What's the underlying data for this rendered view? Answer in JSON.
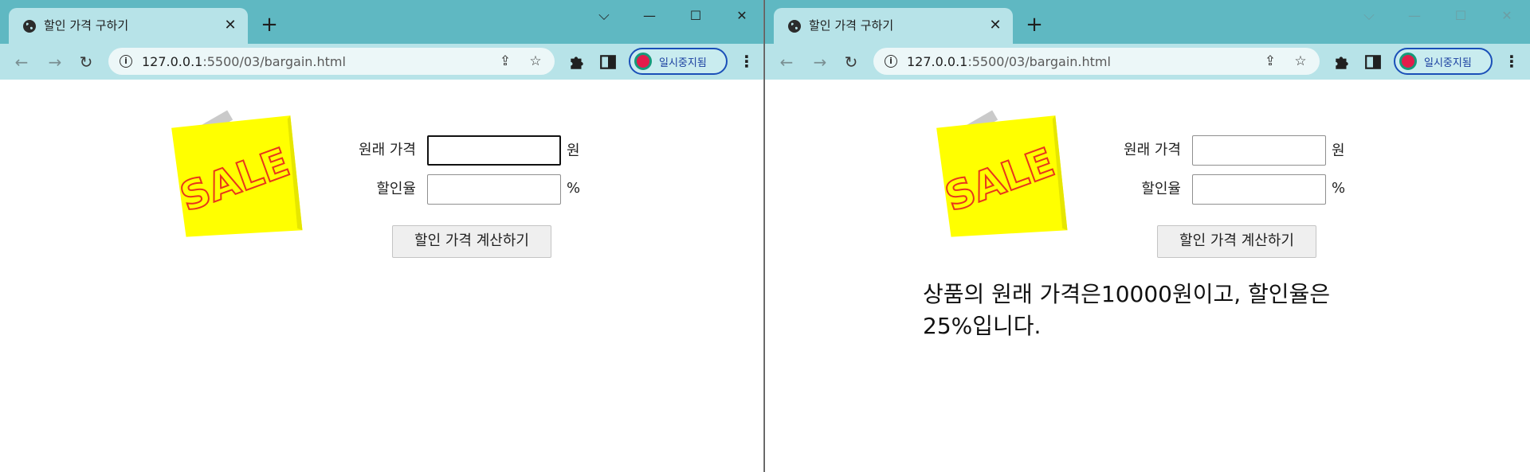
{
  "colors": {
    "tabstrip": "#5fb8c2",
    "toolbar": "#b7e3e8",
    "sale_sticker": "#ffff00",
    "sale_text": "#e8361b",
    "profile_border": "#1a4fb8"
  },
  "windows": [
    {
      "tab": {
        "title": "할인 가격 구하기",
        "close": "✕",
        "new_tab": "+"
      },
      "controls": {
        "tabsearch": "⌵",
        "minimize": "—",
        "maximize": "☐",
        "close": "✕"
      },
      "address": {
        "host": "127.0.0.1",
        "path": ":5500/03/bargain.html"
      },
      "profile_label": "일시중지됨",
      "form": {
        "price_label": "원래 가격",
        "price_value": "",
        "price_unit": "원",
        "rate_label": "할인율",
        "rate_value": "",
        "rate_unit": "%",
        "button_label": "할인 가격 계산하기"
      },
      "sale_text": "SALE",
      "result": ""
    },
    {
      "tab": {
        "title": "할인 가격 구하기",
        "close": "✕",
        "new_tab": "+"
      },
      "controls": {
        "tabsearch": "⌵",
        "minimize": "—",
        "maximize": "☐",
        "close": "✕"
      },
      "address": {
        "host": "127.0.0.1",
        "path": ":5500/03/bargain.html"
      },
      "profile_label": "일시중지됨",
      "form": {
        "price_label": "원래 가격",
        "price_value": "",
        "price_unit": "원",
        "rate_label": "할인율",
        "rate_value": "",
        "rate_unit": "%",
        "button_label": "할인 가격 계산하기"
      },
      "sale_text": "SALE",
      "result": "상품의 원래 가격은10000원이고, 할인율은 25%입니다."
    }
  ]
}
